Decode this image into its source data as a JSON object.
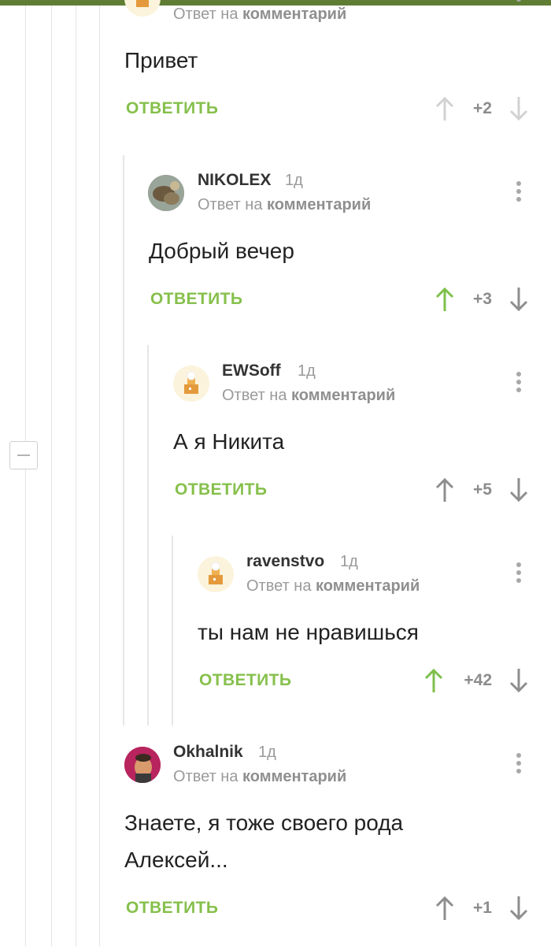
{
  "ui": {
    "reply_label": "ОТВЕТИТЬ",
    "reply_to_prefix": "Ответ на",
    "reply_to_target": "комментарий"
  },
  "comments": [
    {
      "author": "",
      "time": "",
      "text": "Привет",
      "score": "+2",
      "upvoted": false
    },
    {
      "author": "NIKOLEX",
      "time": "1д",
      "text": "Добрый вечер",
      "score": "+3",
      "upvoted": true
    },
    {
      "author": "EWSoff",
      "time": "1д",
      "text": "А я Никита",
      "score": "+5",
      "upvoted": false
    },
    {
      "author": "ravenstvo",
      "time": "1д",
      "text": "ты нам не нравишься",
      "score": "+42",
      "upvoted": true
    },
    {
      "author": "Okhalnik",
      "time": "1д",
      "text_lines": [
        "Знаете, я тоже своего рода",
        "Алексей..."
      ],
      "score": "+1",
      "upvoted": false
    }
  ],
  "colors": {
    "accent": "#86c04c",
    "upvote_active": "#7ec04a",
    "arrow_inactive": "#8e8e8e",
    "arrow_faded": "#d2d2d2",
    "topbar": "#5f7e34"
  },
  "icons": [
    "collapse-icon",
    "kebab-menu-icon",
    "upvote-arrow-icon",
    "downvote-arrow-icon"
  ]
}
